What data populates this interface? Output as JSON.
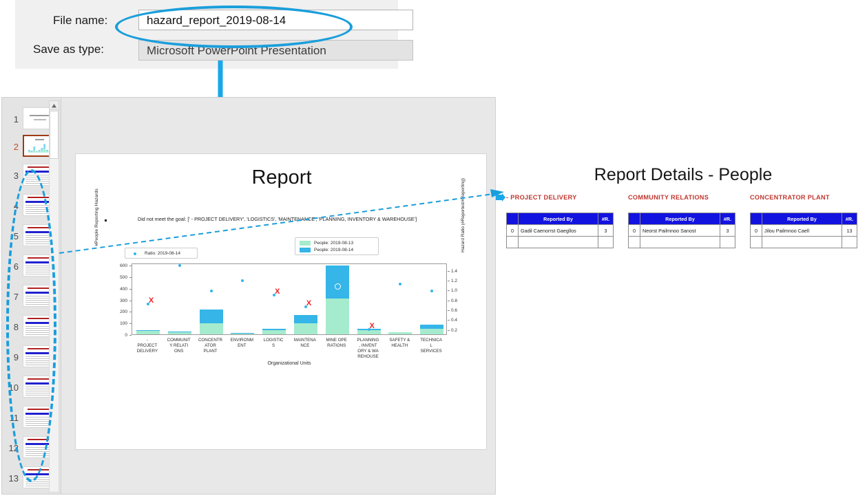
{
  "dialog": {
    "file_name_label": "File name:",
    "file_name_value": "hazard_report_2019-08-14",
    "save_as_type_label": "Save as type:",
    "save_as_type_value": "Microsoft PowerPoint Presentation",
    "highlight_color": "#1a9edb"
  },
  "powerpoint": {
    "thumbnails": [
      {
        "num": "1",
        "kind": "title",
        "active": false
      },
      {
        "num": "2",
        "kind": "chart",
        "active": true
      },
      {
        "num": "3",
        "kind": "table",
        "active": false
      },
      {
        "num": "4",
        "kind": "table",
        "active": false
      },
      {
        "num": "5",
        "kind": "table",
        "active": false
      },
      {
        "num": "6",
        "kind": "table",
        "active": false
      },
      {
        "num": "7",
        "kind": "table",
        "active": false
      },
      {
        "num": "8",
        "kind": "table",
        "active": false
      },
      {
        "num": "9",
        "kind": "table",
        "active": false
      },
      {
        "num": "10",
        "kind": "table",
        "active": false
      },
      {
        "num": "11",
        "kind": "table",
        "active": false
      },
      {
        "num": "12",
        "kind": "table",
        "active": false
      },
      {
        "num": "13",
        "kind": "table",
        "active": false
      }
    ],
    "slide": {
      "title": "Report",
      "bullet": "Did not meet the goal: [' - PROJECT DELIVERY', 'LOGISTICS', 'MAINTENANCE', 'PLANNING, INVENTORY & WAREHOUSE']"
    }
  },
  "chart_data": {
    "type": "bar",
    "title": "",
    "xlabel": "Organizational Units",
    "ylabel": "#People Reporting Hazards",
    "ylabel_right": "Hazard Ratio (#Reported/#Reporting)",
    "ylim": [
      0,
      620
    ],
    "yticks": [
      "0",
      "100",
      "200",
      "300",
      "400",
      "500",
      "600"
    ],
    "ylim_right": [
      0.1,
      1.55
    ],
    "yticks_right": [
      "0.2",
      "0.4",
      "0.6",
      "0.8",
      "1.0",
      "1.2",
      "1.4"
    ],
    "grid": false,
    "legend_position": "upper-left and upper-right",
    "categories": [
      " - PROJECT DELIVERY",
      "COMMUNITY RELATIONS",
      "CONCENTRATOR PLANT",
      "ENVIRONMENT",
      "LOGISTICS",
      "MAINTENANCE",
      "MINE OPERATIONS",
      "PLANNING, INVENTORY & WAREHOUSE",
      "SAFETY & HEALTH",
      "TECHNICAL SERVICES"
    ],
    "tick_lines": [
      [
        " - ",
        "PROJECT",
        "DELIVERY"
      ],
      [
        "COMMUNIT",
        "Y RELATI",
        "ONS"
      ],
      [
        "CONCENTR",
        "ATOR",
        "PLANT"
      ],
      [
        "ENVIRONM",
        "ENT"
      ],
      [
        "LOGISTIC",
        "S"
      ],
      [
        "MAINTENA",
        "NCE"
      ],
      [
        "MINE OPE",
        "RATIONS"
      ],
      [
        "PLANNING",
        ", INVENT",
        "ORY & WA",
        "REHOUSE"
      ],
      [
        "SAFETY &",
        "HEALTH"
      ],
      [
        "TECHNICA",
        "L",
        "SERVICES"
      ]
    ],
    "series": [
      {
        "name": "People: 2019-08-13",
        "color": "#a5ebcd",
        "values": [
          30,
          18,
          96,
          9,
          37,
          98,
          310,
          38,
          15,
          48
        ]
      },
      {
        "name": "People: 2019-08-14",
        "color": "#35b5e8",
        "values": [
          38,
          24,
          214,
          12,
          46,
          165,
          597,
          47,
          19,
          82
        ]
      }
    ],
    "ratio_series": {
      "name": "Ratio: 2019-08-14",
      "color": "#33b4ec",
      "values": [
        0.74,
        1.52,
        1.01,
        1.21,
        0.92,
        0.68,
        1.11,
        0.23,
        1.15,
        1.01
      ]
    },
    "goal_markers": [
      {
        "category_index": 0,
        "marker": "X",
        "color": "#ef2222"
      },
      {
        "category_index": 4,
        "marker": "X",
        "color": "#ef2222"
      },
      {
        "category_index": 5,
        "marker": "X",
        "color": "#ef2222"
      },
      {
        "category_index": 6,
        "marker": "O",
        "color": "#ffffff"
      },
      {
        "category_index": 7,
        "marker": "X",
        "color": "#ef2222"
      }
    ],
    "legend_entries": [
      {
        "label": "Ratio: 2019-08-14",
        "color": "#33b4ec",
        "shape": "dot"
      },
      {
        "label": "People: 2019-08-13",
        "color": "#a5ebcd",
        "shape": "bar"
      },
      {
        "label": "People: 2019-08-14",
        "color": "#35b5e8",
        "shape": "bar"
      }
    ]
  },
  "details": {
    "title": "Report Details - People",
    "header_color": "#1313e0",
    "unit_color": "#c0372f",
    "columns": [
      "",
      "Reported By",
      "#R."
    ],
    "units": [
      {
        "name": "- PROJECT DELIVERY",
        "has_arrow": true,
        "rows": [
          [
            "0",
            "Gadil Caenorrst Gaegllos",
            "3"
          ]
        ]
      },
      {
        "name": "COMMUNITY RELATIONS",
        "has_arrow": false,
        "rows": [
          [
            "0",
            "Neorst Pailmnoo Sanost",
            "3"
          ]
        ]
      },
      {
        "name": "CONCENTRATOR PLANT",
        "has_arrow": false,
        "rows": [
          [
            "0",
            "Jilou Pailmnoo Caell",
            "13"
          ]
        ]
      }
    ]
  }
}
